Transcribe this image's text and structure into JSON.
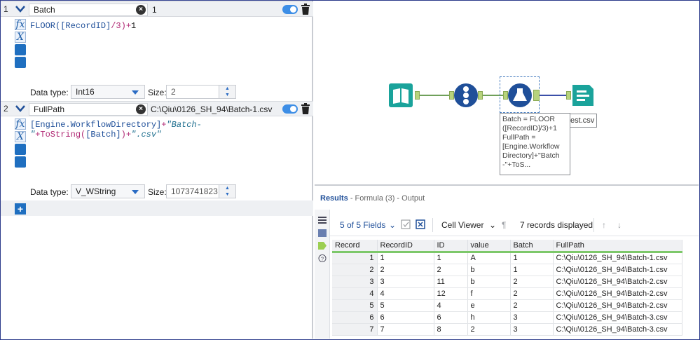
{
  "formulas": [
    {
      "index": "1",
      "field": "Batch",
      "preview": "1",
      "expression": {
        "fn": "FLOOR(",
        "arg": "[RecordID]",
        "op": "/3)+",
        "num": "1"
      },
      "data_type": "Int16",
      "size": "2"
    },
    {
      "index": "2",
      "field": "FullPath",
      "preview": "C:\\Qiu\\0126_SH_94\\Batch-1.csv",
      "expression_line1": {
        "name": "[Engine.WorkflowDirectory]",
        "plus": "+",
        "str": "\"Batch-"
      },
      "expression_line2": {
        "str": "\"",
        "plus": "+ToString(",
        "name": "[Batch]",
        "close": ")+",
        "str2": "\".csv\""
      },
      "data_type": "V_WString",
      "size": "1073741823"
    }
  ],
  "labels": {
    "data_type": "Data type:",
    "size": "Size:"
  },
  "canvas": {
    "tooltip": "Batch = FLOOR\n([RecordID]/3)+1\nFullPath =\n[Engine.Workflow\nDirectory]+\"Batch\n-\"+ToS...",
    "output_label": "est.csv"
  },
  "results": {
    "title": "Results",
    "subtitle": "- Formula (3) - Output",
    "fields_label": "5 of 5 Fields",
    "cell_viewer": "Cell Viewer",
    "records_label": "7 records displayed",
    "columns": [
      "Record",
      "RecordID",
      "ID",
      "value",
      "Batch",
      "FullPath"
    ],
    "rows": [
      [
        "1",
        "1",
        "1",
        "A",
        "1",
        "C:\\Qiu\\0126_SH_94\\Batch-1.csv"
      ],
      [
        "2",
        "2",
        "2",
        "b",
        "1",
        "C:\\Qiu\\0126_SH_94\\Batch-1.csv"
      ],
      [
        "3",
        "3",
        "11",
        "b",
        "2",
        "C:\\Qiu\\0126_SH_94\\Batch-2.csv"
      ],
      [
        "4",
        "4",
        "12",
        "f",
        "2",
        "C:\\Qiu\\0126_SH_94\\Batch-2.csv"
      ],
      [
        "5",
        "5",
        "4",
        "e",
        "2",
        "C:\\Qiu\\0126_SH_94\\Batch-2.csv"
      ],
      [
        "6",
        "6",
        "6",
        "h",
        "3",
        "C:\\Qiu\\0126_SH_94\\Batch-3.csv"
      ],
      [
        "7",
        "7",
        "8",
        "2",
        "3",
        "C:\\Qiu\\0126_SH_94\\Batch-3.csv"
      ]
    ]
  },
  "colors": {
    "accent": "#1f6fc0",
    "grid_header_line": "#7dc86a",
    "tool_teal": "#1aa39b",
    "tool_blue": "#1f4f99"
  }
}
